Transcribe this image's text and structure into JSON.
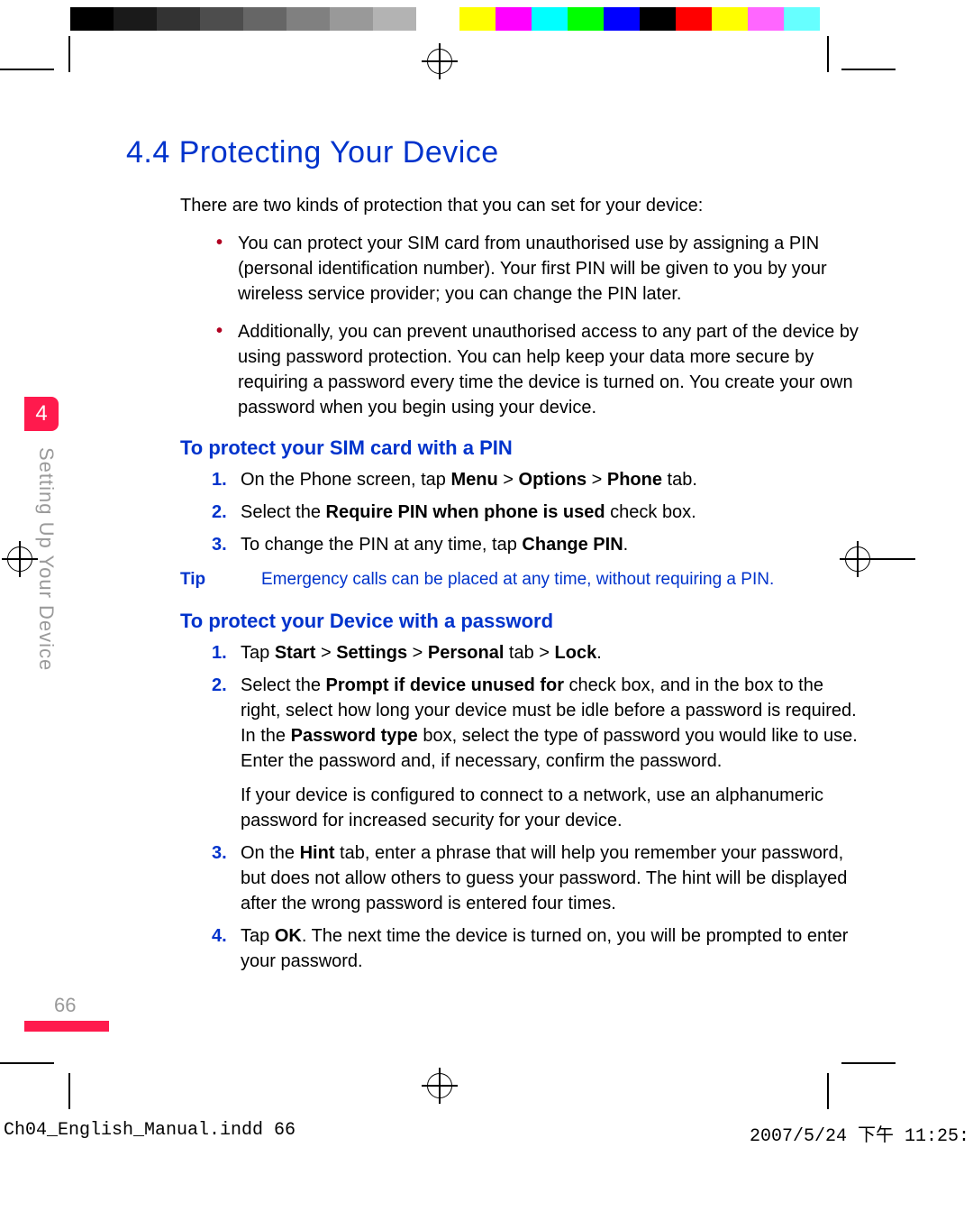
{
  "calib_colors": [
    "#000000",
    "#1a1a1a",
    "#333333",
    "#4d4d4d",
    "#666666",
    "#808080",
    "#999999",
    "#b3b3b3",
    "#ffffff",
    "#ffff00",
    "#ff00ff",
    "#00ffff",
    "#00ff00",
    "#0000ff",
    "#000000",
    "#ff0000",
    "#ffff00",
    "#ff66ff",
    "#66ffff",
    "#ffffff"
  ],
  "calib_widths": [
    48,
    48,
    48,
    48,
    48,
    48,
    48,
    48,
    48,
    40,
    40,
    40,
    40,
    40,
    40,
    40,
    40,
    40,
    40,
    40
  ],
  "heading": "4.4 Protecting Your Device",
  "intro": "There are two kinds of protection that you can set for your device:",
  "bullets": [
    "You can protect your SIM card from unauthorised use by assigning a PIN (personal identification number). Your first PIN will be given to you by your wireless service provider; you can change the PIN later.",
    "Additionally, you can prevent unauthorised access to any part of the device by using password protection. You can help keep your data more secure by requiring a password every time the device is turned on. You create your own password when you begin using your device."
  ],
  "section1_title": "To protect your SIM card with a PIN",
  "section1_items": [
    {
      "pre": "On the Phone screen, tap ",
      "b1": "Menu",
      "mid1": " > ",
      "b2": "Options",
      "mid2": " > ",
      "b3": "Phone",
      "post": " tab."
    },
    {
      "pre": "Select the ",
      "b1": "Require PIN when phone is used",
      "post": " check box."
    },
    {
      "pre": "To change the PIN at any time, tap ",
      "b1": "Change PIN",
      "post": "."
    }
  ],
  "tip_label": "Tip",
  "tip_text": "Emergency calls can be placed at any time, without requiring a PIN.",
  "section2_title": "To protect your Device with a password",
  "section2_items": [
    {
      "segments": [
        {
          "t": "Tap "
        },
        {
          "t": "Start",
          "b": true
        },
        {
          "t": " > "
        },
        {
          "t": "Settings",
          "b": true
        },
        {
          "t": " > "
        },
        {
          "t": "Personal",
          "b": true
        },
        {
          "t": " tab > "
        },
        {
          "t": "Lock",
          "b": true
        },
        {
          "t": "."
        }
      ]
    },
    {
      "segments": [
        {
          "t": "Select the "
        },
        {
          "t": "Prompt if device unused for",
          "b": true
        },
        {
          "t": " check box, and in the box to the right, select how long your device must be idle before a password is required. In the "
        },
        {
          "t": "Password type",
          "b": true
        },
        {
          "t": " box, select the type of password you would like to use. Enter the password and, if necessary, confirm the password."
        }
      ],
      "para2": "If your device is configured to connect to a network, use an alphanumeric password for increased security for your device."
    },
    {
      "segments": [
        {
          "t": "On the "
        },
        {
          "t": "Hint",
          "b": true
        },
        {
          "t": " tab, enter a phrase that will help you remember your password, but does not allow others to guess your password. The hint will be displayed after the wrong password is entered four times."
        }
      ]
    },
    {
      "segments": [
        {
          "t": "Tap "
        },
        {
          "t": "OK",
          "b": true
        },
        {
          "t": ". The next time the device is turned on, you will be prompted to enter your password."
        }
      ]
    }
  ],
  "chapter_num": "4",
  "side_text": "Setting Up Your Device",
  "page_num": "66",
  "slug_left": "Ch04_English_Manual.indd   66",
  "slug_right": "2007/5/24   下午 11:25:"
}
